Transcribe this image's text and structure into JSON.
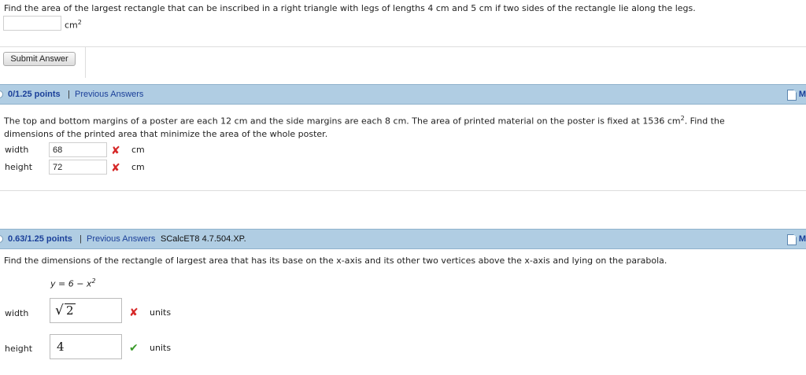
{
  "q1": {
    "prompt": "Find the area of the largest rectangle that can be inscribed in a right triangle with legs of lengths 4 cm and 5 cm if two sides of the rectangle lie along the legs.",
    "answer_value": "",
    "unit_base": "cm",
    "unit_exp": "2",
    "submit_label": "Submit Answer"
  },
  "q2": {
    "points": "0/1.25 points",
    "separator": "|",
    "prev_answers": "Previous Answers",
    "prompt_line1_a": "The top and bottom margins of a poster are each 12 cm and the side margins are each 8 cm. The area of printed material on the poster is fixed at 1536 cm",
    "prompt_line1_exp": "2",
    "prompt_line1_b": ". Find the",
    "prompt_line2": "dimensions of the printed area that minimize the area of the whole poster.",
    "width_label": "width",
    "width_value": "68",
    "width_unit": "cm",
    "height_label": "height",
    "height_value": "72",
    "height_unit": "cm",
    "mark_wrong": "✘",
    "side_marker": "M"
  },
  "q3": {
    "points": "0.63/1.25 points",
    "separator": "|",
    "prev_answers": "Previous Answers",
    "source": "SCalcET8 4.7.504.XP.",
    "prompt": "Find the dimensions of the rectangle of largest area that has its base on the x-axis and its other two vertices above the x-axis and lying on the parabola.",
    "equation_lhs": "y = 6 − x",
    "equation_exp": "2",
    "width_label": "width",
    "width_radicand": "2",
    "width_radical": "√",
    "width_unit": "units",
    "height_label": "height",
    "height_value": "4",
    "height_unit": "units",
    "mark_wrong": "✘",
    "mark_right": "✔",
    "side_marker": "M"
  }
}
